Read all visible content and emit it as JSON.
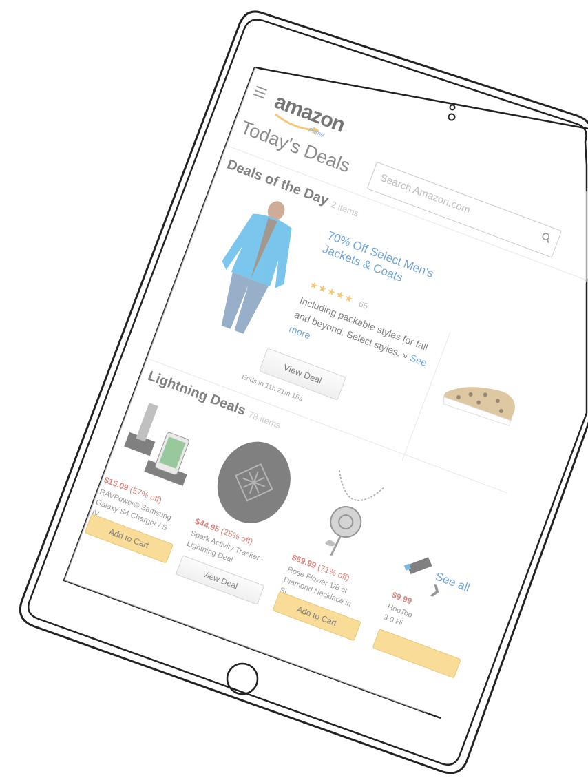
{
  "header": {
    "menu_icon": "hamburger-menu-icon",
    "logo_text": "amazon",
    "logo_subtext": "Prime",
    "page_title": "Today's Deals"
  },
  "search": {
    "placeholder": "Search Amazon.com",
    "icon": "search-icon"
  },
  "deals_of_the_day": {
    "title": "Deals of the Day",
    "count": "2 items",
    "deal": {
      "title": "70% Off Select Men's Jackets & Coats",
      "rating": 4.5,
      "stars": "★★★★★",
      "rating_count": "65",
      "description": "Including packable styles for fall and beyond. Select styles.",
      "see_more_prefix": "»",
      "see_more": "See more",
      "button": "View Deal",
      "ends_text": "Ends in 11h 21m 16s"
    }
  },
  "lightning_deals": {
    "title": "Lightning Deals",
    "count": "78 items",
    "see_all": "See all",
    "items": [
      {
        "price": "$15.09",
        "discount": "(57% off)",
        "name": "RAVPower® Samsung Galaxy S4 Charger / S IV...",
        "button": "Add to Cart"
      },
      {
        "price": "$44.95",
        "discount": "(25% off)",
        "name": "Spark Activity Tracker - Lightning Deal",
        "button": "View Deal"
      },
      {
        "price": "$69.99",
        "discount": "(71% off)",
        "name": "Rose Flower 1/8 ct Diamond Necklace in Si...",
        "button": "Add to Cart"
      },
      {
        "price": "$9.99",
        "discount": "",
        "name": "HooToo 3.0 Hi",
        "button": ""
      }
    ]
  },
  "colors": {
    "link": "#1a6fbf",
    "price": "#c0392b",
    "add_to_cart": "#f5c75a",
    "star": "#f2a623"
  }
}
